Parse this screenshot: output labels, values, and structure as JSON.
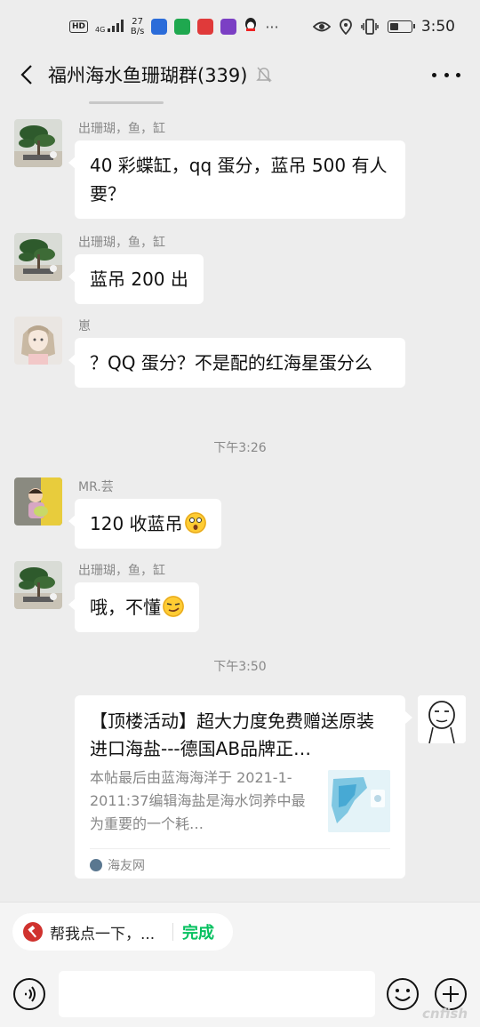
{
  "status_bar": {
    "hd": "HD",
    "network": "4G",
    "speed_value": "27",
    "speed_unit": "B/s",
    "time": "3:50",
    "app_icons": [
      "baidu-map-icon",
      "book-app-icon",
      "red-book-icon",
      "purple-app-icon",
      "qq-icon"
    ],
    "app_colors": [
      "#2b6cd9",
      "#1fa84f",
      "#e03a3a",
      "#7b3fc4",
      "#f7c600"
    ]
  },
  "header": {
    "title": "福州海水鱼珊瑚群(339)",
    "mute_icon": "bell-off-icon",
    "more_icon": "more-dots-icon"
  },
  "messages": [
    {
      "sender": "出珊瑚，鱼，缸",
      "text": "40 彩蝶缸，qq 蛋分，蓝吊 500 有人要？",
      "avatar": "bonsai-avatar"
    },
    {
      "sender": "出珊瑚，鱼，缸",
      "text": "蓝吊 200 出",
      "avatar": "bonsai-avatar"
    },
    {
      "sender": "崽",
      "text": "？QQ 蛋分？不是配的红海星蛋分么",
      "avatar": "anime-avatar"
    },
    {
      "sender": "MR.芸",
      "text": "120 收蓝吊",
      "avatar": "child-avatar",
      "emoji": "shocked-emoji"
    },
    {
      "sender": "出珊瑚，鱼，缸",
      "text": "哦，不懂",
      "avatar": "bonsai-avatar",
      "emoji": "smirk-emoji"
    }
  ],
  "time_dividers": [
    "下午3:26",
    "下午3:50"
  ],
  "link_card": {
    "title": "【顶楼活动】超大力度免费赠送原装进口海盐---德国AB品牌正…",
    "description": "本帖最后由蓝海海洋于 2021-1-2011:37编辑海盐是海水饲养中最为重要的一个耗…",
    "source": "海友网",
    "sender_avatar": "sketch-face-avatar"
  },
  "quick_reply": {
    "text": "帮我点一下，...",
    "done": "完成",
    "icon": "hammer-icon"
  },
  "input_bar": {
    "voice_icon": "voice-icon",
    "input_value": "",
    "input_placeholder": "",
    "emoji_icon": "emoji-icon",
    "plus_icon": "plus-icon"
  },
  "watermark": "cnfish"
}
